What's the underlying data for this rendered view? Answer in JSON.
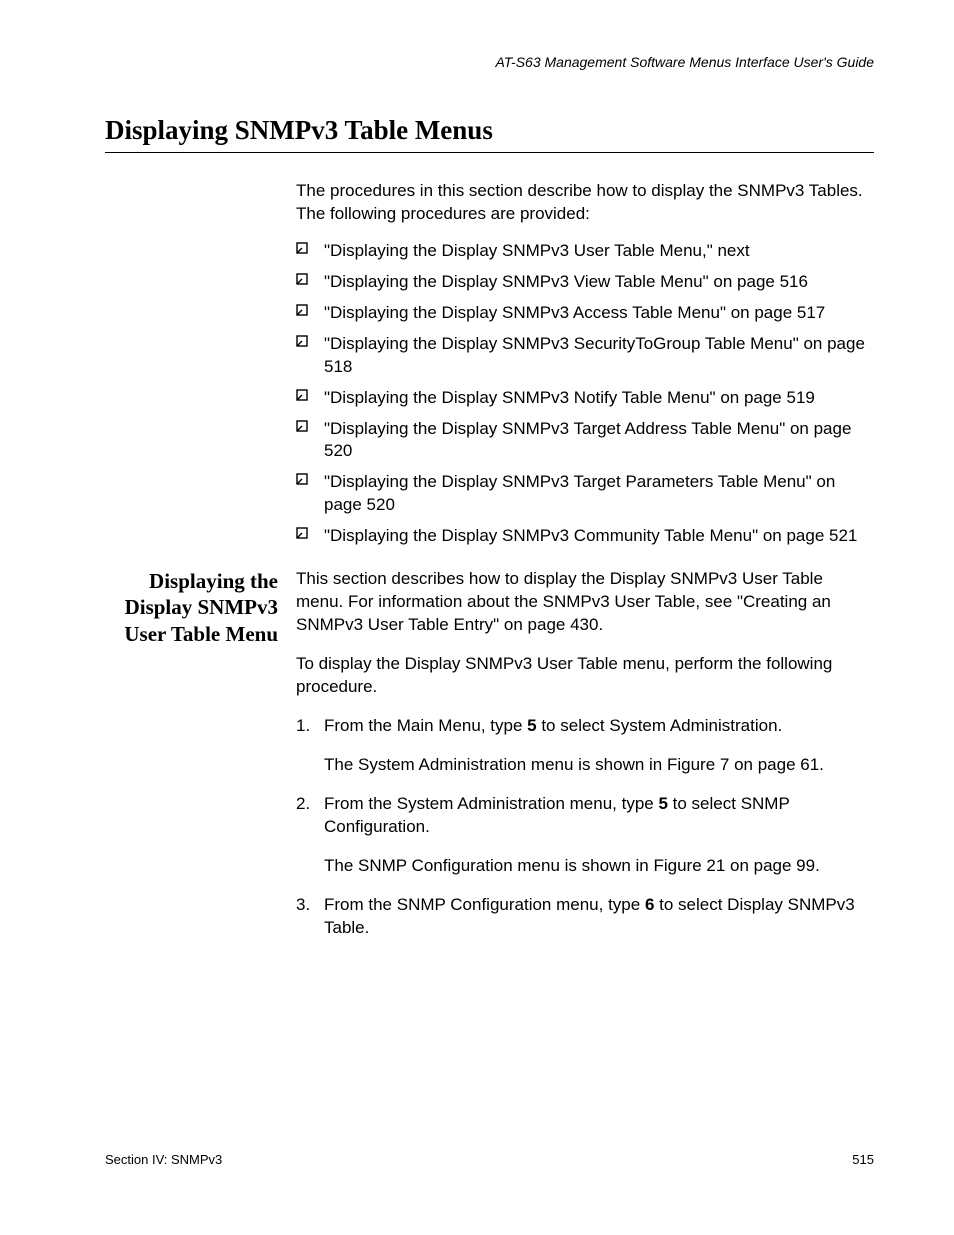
{
  "header": {
    "running_title": "AT-S63 Management Software Menus Interface User's Guide"
  },
  "title": "Displaying SNMPv3 Table Menus",
  "intro": "The procedures in this section describe how to display the SNMPv3 Tables. The following procedures are provided:",
  "bullets": [
    "\"Displaying the Display SNMPv3 User Table Menu,\"  next",
    "\"Displaying the Display SNMPv3 View Table Menu\" on page 516",
    "\"Displaying the Display SNMPv3 Access Table Menu\" on page 517",
    "\"Displaying the Display SNMPv3 SecurityToGroup Table Menu\" on page 518",
    "\"Displaying the Display SNMPv3 Notify Table Menu\" on page 519",
    "\"Displaying the Display SNMPv3 Target Address Table Menu\" on page 520",
    "\"Displaying the Display SNMPv3 Target Parameters Table Menu\" on page 520",
    "\"Displaying the Display SNMPv3 Community Table Menu\" on page 521"
  ],
  "subsection": {
    "title": "Displaying the Display SNMPv3 User Table Menu",
    "para1": "This section describes how to display the Display SNMPv3 User Table menu. For information about the SNMPv3 User Table, see \"Creating an SNMPv3 User Table Entry\" on page 430.",
    "para2": "To display the Display SNMPv3 User Table menu, perform the following procedure.",
    "steps": [
      {
        "num": "1.",
        "pre": "From the Main Menu, type ",
        "bold": "5",
        "post": " to select System Administration.",
        "sub": "The System Administration menu is shown in Figure 7 on page 61."
      },
      {
        "num": "2.",
        "pre": "From the System Administration menu, type ",
        "bold": "5",
        "post": " to select SNMP Configuration.",
        "sub": "The SNMP Configuration menu is shown in Figure 21 on page 99."
      },
      {
        "num": "3.",
        "pre": "From the SNMP Configuration menu, type ",
        "bold": "6",
        "post": " to select Display SNMPv3 Table.",
        "sub": ""
      }
    ]
  },
  "footer": {
    "section": "Section IV: SNMPv3",
    "page": "515"
  }
}
